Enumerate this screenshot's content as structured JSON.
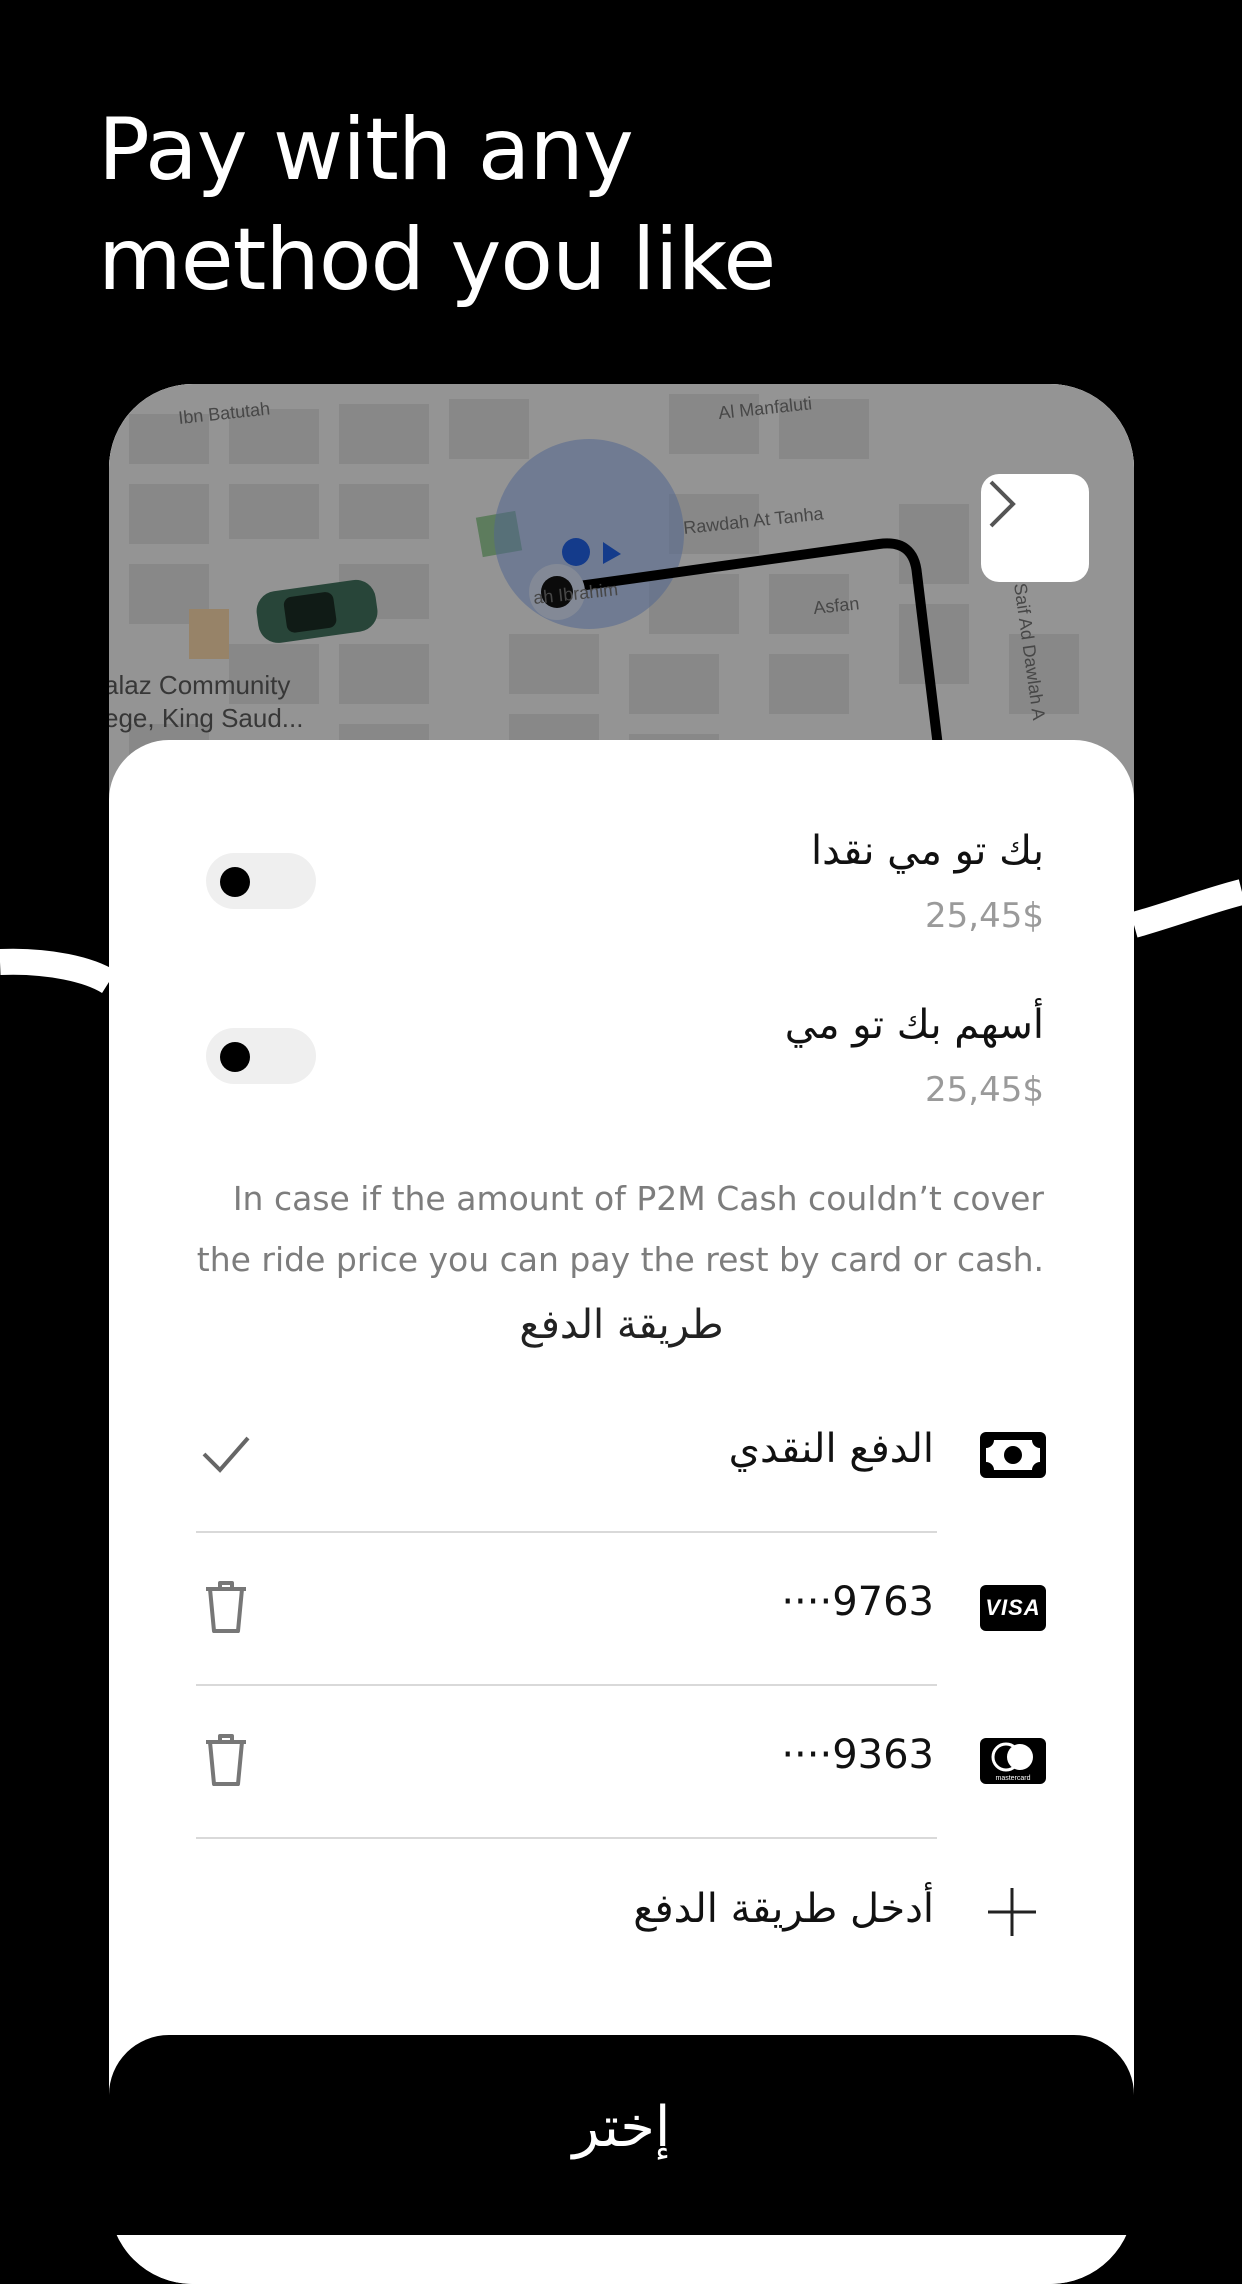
{
  "headline": {
    "line1": "Pay with any",
    "line2": "method you like"
  },
  "map": {
    "streets": {
      "ibn_batutah": "Ibn Batutah",
      "al_manfaluti": "Al Manfaluti",
      "rawdah": "Rawdah At Tanha",
      "ibrahim": "ah Ibrahim",
      "asfan": "Asfan",
      "saif": "Saif Ad Dawlah A",
      "college_line1": "alaz Community",
      "college_line2": "ege, King Saud..."
    },
    "next_icon": "chevron-right-icon"
  },
  "options": [
    {
      "title": "بك تو مي نقدا",
      "price": "25,45$",
      "enabled": false
    },
    {
      "title": "أسهم بك تو مي",
      "price": "25,45$",
      "enabled": false
    }
  ],
  "note": {
    "line1": "In case if the amount of P2M Cash couldn’t cover",
    "line2": "the ride price you can pay the rest by card or cash."
  },
  "payment": {
    "section_title": "طريقة الدفع",
    "methods": [
      {
        "label": "الدفع النقدي",
        "icon": "cash-icon",
        "action_icon": "checkmark-icon"
      },
      {
        "label": "····9763",
        "icon": "visa-icon",
        "brand_text": "VISA",
        "action_icon": "trash-icon"
      },
      {
        "label": "····9363",
        "icon": "mastercard-icon",
        "brand_text": "mastercard",
        "action_icon": "trash-icon"
      }
    ],
    "add_label": "أدخل طريقة الدفع",
    "add_icon": "plus-icon"
  },
  "cta": {
    "label": "إختر"
  }
}
